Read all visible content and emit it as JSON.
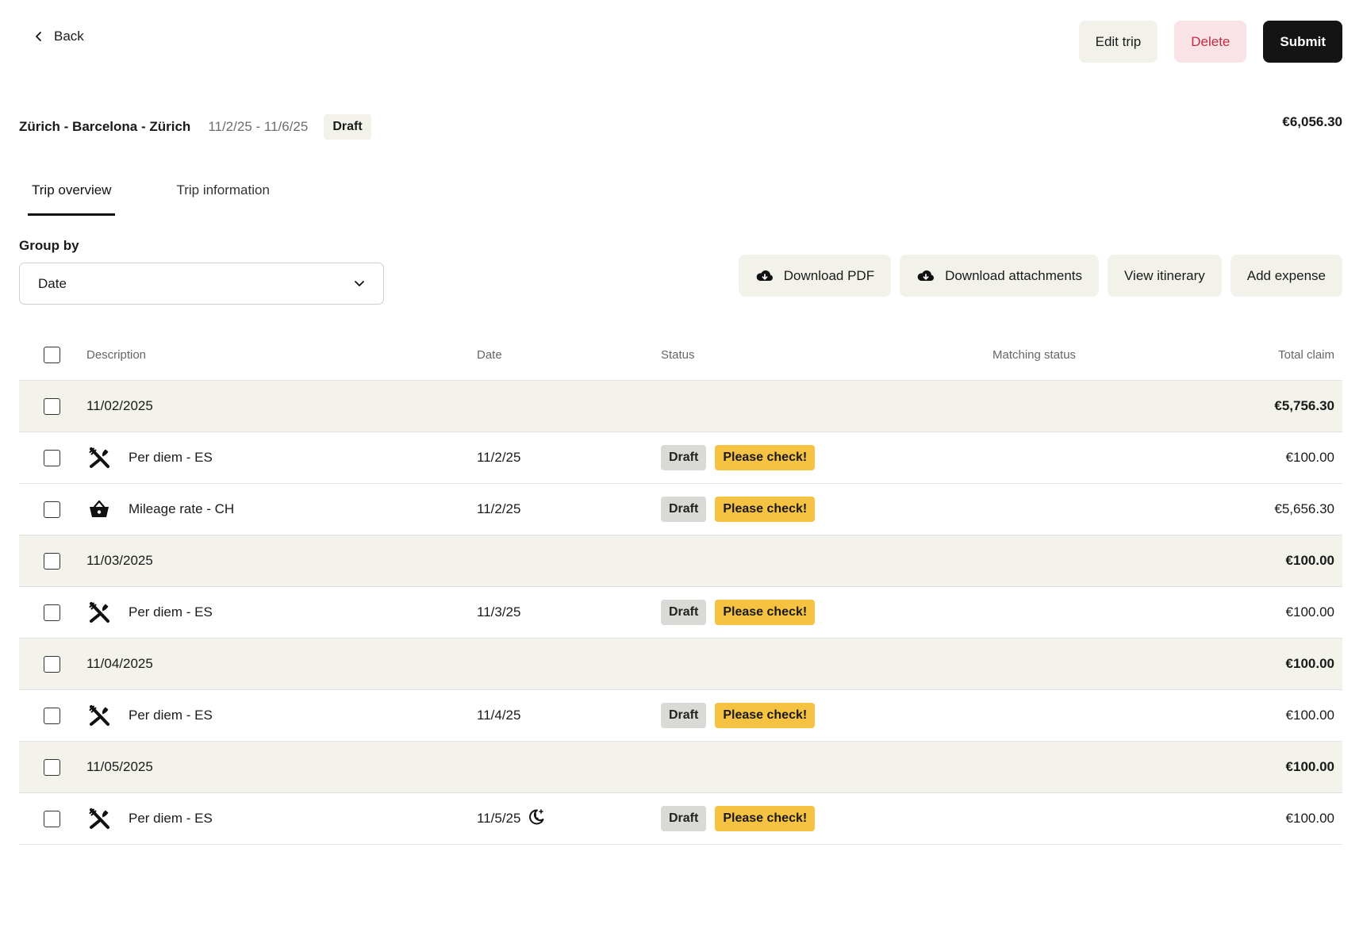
{
  "header": {
    "back_label": "Back",
    "edit_label": "Edit trip",
    "delete_label": "Delete",
    "submit_label": "Submit"
  },
  "trip": {
    "title": "Zürich - Barcelona - Zürich",
    "dates": "11/2/25 - 11/6/25",
    "status": "Draft",
    "total": "€6,056.30"
  },
  "tabs": [
    {
      "label": "Trip overview",
      "active": true
    },
    {
      "label": "Trip information",
      "active": false
    }
  ],
  "group_by": {
    "label": "Group by",
    "value": "Date"
  },
  "actions": {
    "download_pdf": "Download PDF",
    "download_attachments": "Download attachments",
    "view_itinerary": "View itinerary",
    "add_expense": "Add expense"
  },
  "table": {
    "columns": {
      "description": "Description",
      "date": "Date",
      "status": "Status",
      "matching": "Matching status",
      "total": "Total claim"
    },
    "groups": [
      {
        "date": "11/02/2025",
        "total": "€5,756.30",
        "items": [
          {
            "icon": "cutlery-icon",
            "description": "Per diem - ES",
            "date": "11/2/25",
            "status": "Draft",
            "check": "Please check!",
            "total": "€100.00"
          },
          {
            "icon": "basket-icon",
            "description": "Mileage rate - CH",
            "date": "11/2/25",
            "status": "Draft",
            "check": "Please check!",
            "total": "€5,656.30"
          }
        ]
      },
      {
        "date": "11/03/2025",
        "total": "€100.00",
        "items": [
          {
            "icon": "cutlery-icon",
            "description": "Per diem - ES",
            "date": "11/3/25",
            "status": "Draft",
            "check": "Please check!",
            "total": "€100.00"
          }
        ]
      },
      {
        "date": "11/04/2025",
        "total": "€100.00",
        "items": [
          {
            "icon": "cutlery-icon",
            "description": "Per diem - ES",
            "date": "11/4/25",
            "status": "Draft",
            "check": "Please check!",
            "total": "€100.00"
          }
        ]
      },
      {
        "date": "11/05/2025",
        "total": "€100.00",
        "items": [
          {
            "icon": "cutlery-icon",
            "description": "Per diem - ES",
            "date": "11/5/25",
            "date_icon": "overnight-icon",
            "status": "Draft",
            "check": "Please check!",
            "total": "€100.00"
          }
        ]
      }
    ]
  }
}
